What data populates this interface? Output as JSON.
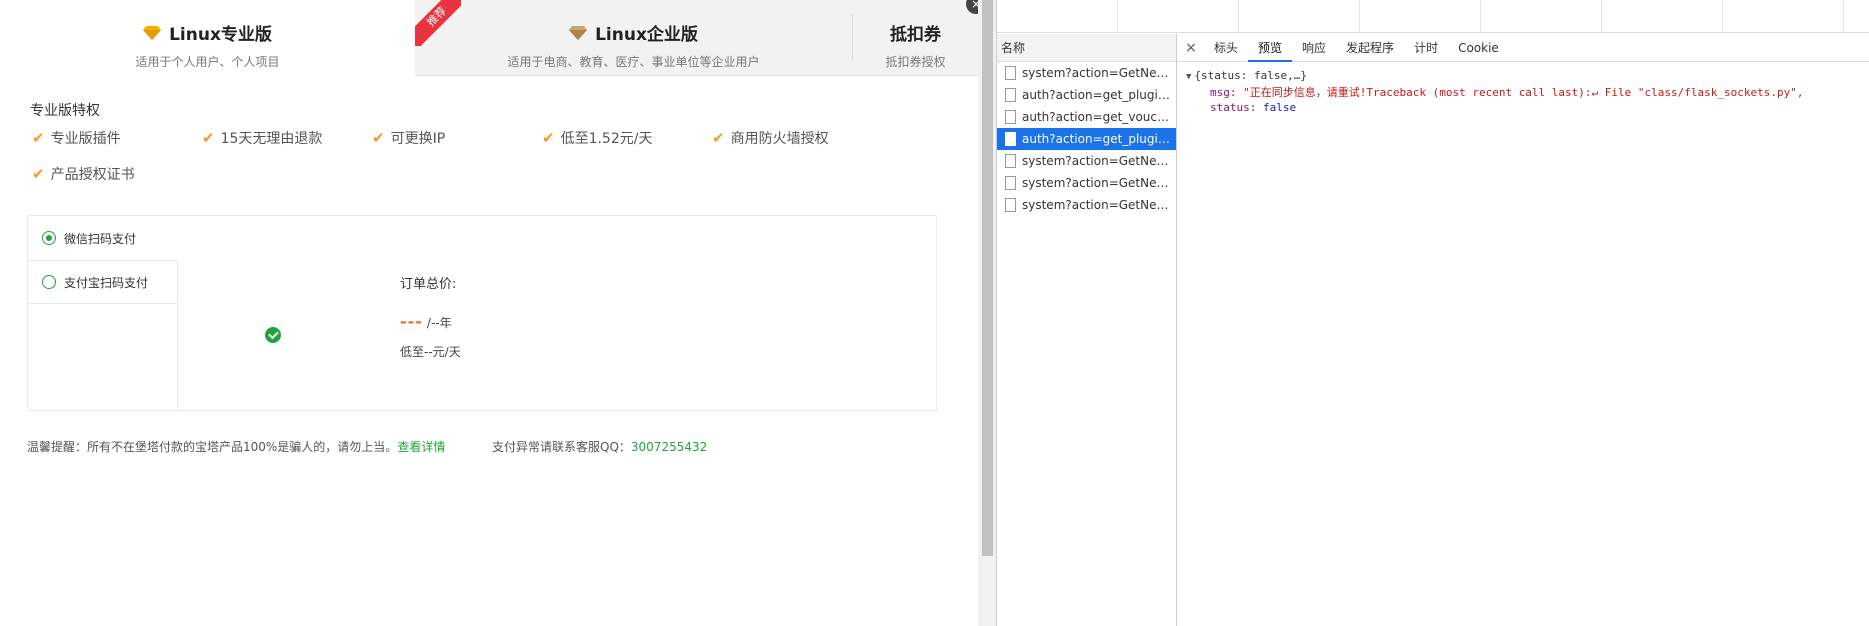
{
  "tabs": [
    {
      "title": "Linux专业版",
      "subtitle": "适用于个人用户、个人项目"
    },
    {
      "title": "Linux企业版",
      "subtitle": "适用于电商、教育、医疗、事业单位等企业用户"
    },
    {
      "title": "抵扣券",
      "subtitle": "抵扣券授权"
    }
  ],
  "ribbon_label": "推荐",
  "privileges": {
    "title": "专业版特权",
    "items": [
      "专业版插件",
      "15天无理由退款",
      "可更换IP",
      "低至1.52元/天",
      "商用防火墙授权",
      "产品授权证书"
    ]
  },
  "payment": {
    "methods": [
      "微信扫码支付",
      "支付宝扫码支付"
    ],
    "order_label": "订单总价:",
    "price": "---",
    "per_year": "/--年",
    "per_day": "低至--元/天"
  },
  "footer": {
    "warning": "温馨提醒：所有不在堡塔付款的宝塔产品100%是骗人的，请勿上当。",
    "details_link": "查看详情",
    "contact_label": "支付异常请联系客服QQ：",
    "contact_qq": "3007255432"
  },
  "devtools": {
    "list_header": "名称",
    "requests": [
      "system?action=GetNetW...",
      "auth?action=get_plugin_...",
      "auth?action=get_vouche...",
      "auth?action=get_plugin_...",
      "system?action=GetNetW...",
      "system?action=GetNetW...",
      "system?action=GetNetW..."
    ],
    "selected_index": 3,
    "close_glyph": "×",
    "tabs": [
      "标头",
      "预览",
      "响应",
      "发起程序",
      "计时",
      "Cookie"
    ],
    "active_tab": "预览",
    "preview": {
      "summary": "{status: false,…}",
      "msg_key": "msg:",
      "msg_value": "\"正在同步信息，请重试!Traceback (most recent call last):↵  File \"class/flask_sockets.py\",",
      "status_key": "status:",
      "status_value": "false"
    }
  },
  "colors": {
    "accent_green": "#20a53a",
    "check_orange": "#f59a23",
    "price_orange": "#f56c1f",
    "ribbon_red": "#e8343f",
    "devtools_blue": "#1a73e8"
  }
}
